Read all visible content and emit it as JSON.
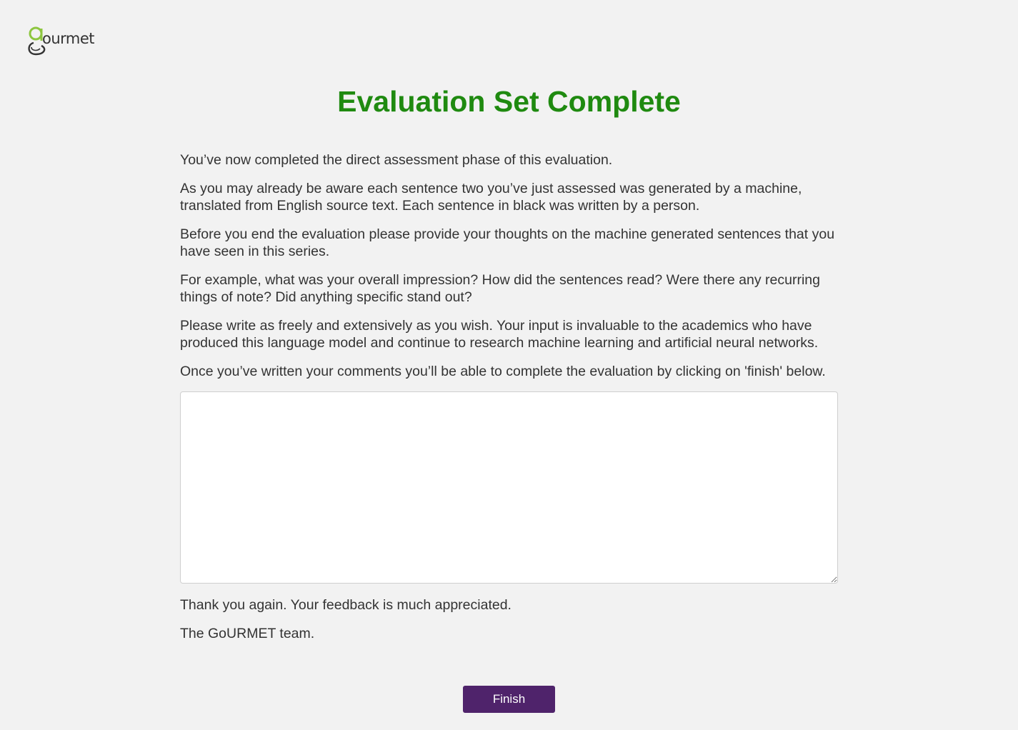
{
  "brand": {
    "logo_text": "ourmet",
    "logo_letter_color": "#8dc63f"
  },
  "page": {
    "title": "Evaluation Set Complete",
    "title_color": "#1f8a10",
    "paragraphs": [
      "You’ve now completed the direct assessment phase of this evaluation.",
      "As you may already be aware each sentence two you’ve just assessed was generated by a machine, translated from English source text. Each sentence in black was written by a person.",
      "Before you end the evaluation please provide your thoughts on the machine generated sentences that you have seen in this series.",
      "For example, what was your overall impression? How did the sentences read? Were there any recurring things of note? Did anything specific stand out?",
      "Please write as freely and extensively as you wish. Your input is invaluable to the academics who have produced this language model and continue to research machine learning and artificial neural networks.",
      "Once you’ve written your comments you’ll be able to complete the evaluation by clicking on 'finish' below."
    ],
    "comments_value": "",
    "closing": [
      "Thank you again. Your feedback is much appreciated.",
      "The GoURMET team."
    ],
    "finish_label": "Finish",
    "finish_color": "#4f236b"
  }
}
